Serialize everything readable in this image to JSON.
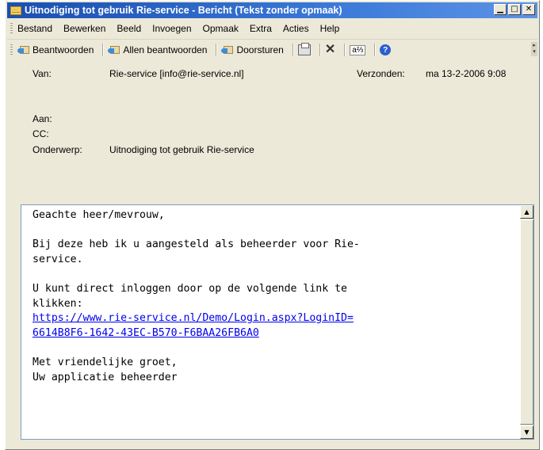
{
  "window": {
    "title": "Uitnodiging tot gebruik Rie-service - Bericht (Tekst zonder opmaak)",
    "icon": "envelope-icon"
  },
  "menu": [
    "Bestand",
    "Bewerken",
    "Beeld",
    "Invoegen",
    "Opmaak",
    "Extra",
    "Acties",
    "Help"
  ],
  "toolbar": {
    "reply": "Beantwoorden",
    "reply_all": "Allen beantwoorden",
    "forward": "Doorsturen"
  },
  "header": {
    "from_label": "Van:",
    "from_value": "Rie-service [info@rie-service.nl]",
    "sent_label": "Verzonden:",
    "sent_value": "ma 13-2-2006 9:08",
    "to_label": "Aan:",
    "cc_label": "CC:",
    "subject_label": "Onderwerp:",
    "subject_value": "Uitnodiging tot gebruik Rie-service"
  },
  "body": {
    "greeting": "Geachte heer/mevrouw,",
    "line1": "Bij deze heb ik u aangesteld als beheerder voor Rie-",
    "line2": "service.",
    "line3": "U kunt direct inloggen door op de volgende link te",
    "line4": "klikken:",
    "link1": "https://www.rie-service.nl/Demo/Login.aspx?LoginID=",
    "link2": "6614B8F6-1642-43EC-B570-F6BAA26FB6A0",
    "closing1": "Met vriendelijke groet,",
    "closing2": "Uw applicatie beheerder"
  }
}
